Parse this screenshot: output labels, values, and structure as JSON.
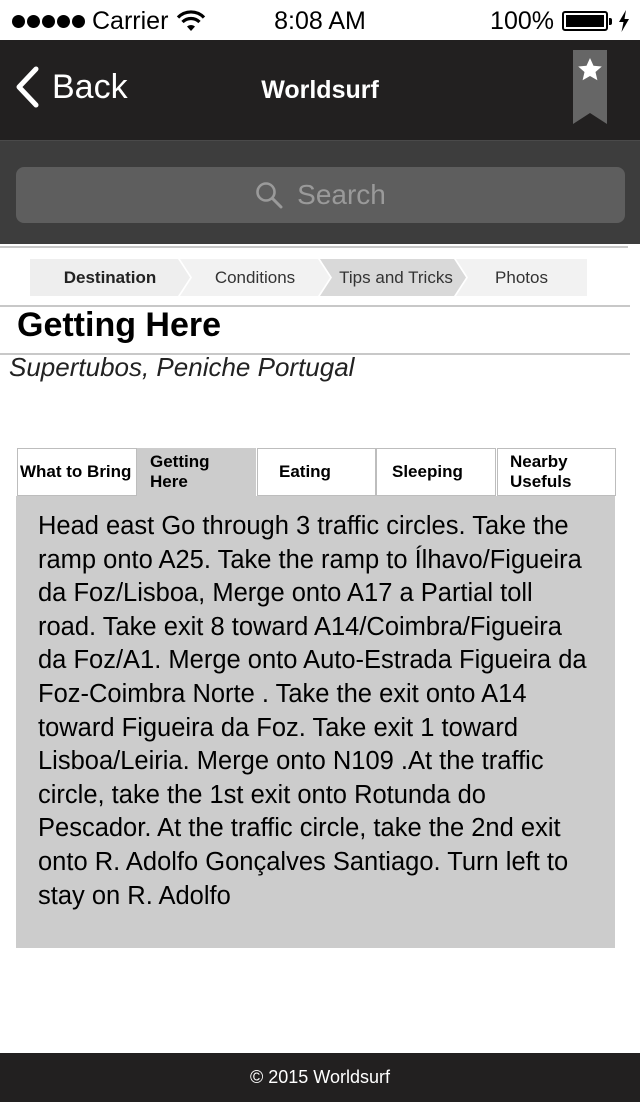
{
  "status_bar": {
    "carrier": "Carrier",
    "time": "8:08 AM",
    "battery": "100%",
    "signal_icon": "signal-dots-icon",
    "wifi_icon": "wifi-icon",
    "battery_icon": "battery-icon",
    "charging_icon": "bolt-icon"
  },
  "nav": {
    "back_label": "Back",
    "title": "Worldsurf",
    "back_icon": "chevron-left-icon",
    "bookmark_icon": "bookmark-star-icon"
  },
  "search": {
    "placeholder": "Search",
    "icon": "search-icon"
  },
  "steps": [
    {
      "label": "Destination",
      "state": "done"
    },
    {
      "label": "Conditions",
      "state": "default"
    },
    {
      "label": "Tips and Tricks",
      "state": "highlight"
    },
    {
      "label": "Photos",
      "state": "default"
    }
  ],
  "page": {
    "title": "Getting Here",
    "subtitle": "Supertubos, Peniche Portugal"
  },
  "tabs": [
    {
      "label": "What to Bring",
      "active": false
    },
    {
      "label": "Getting Here",
      "active": true
    },
    {
      "label": "Eating",
      "active": false
    },
    {
      "label": "Sleeping",
      "active": false
    },
    {
      "label": "Nearby Usefuls",
      "active": false
    }
  ],
  "content": {
    "text": "Head east Go through 3 traffic circles. Take the ramp onto A25. Take the ramp to Ílhavo/Figueira da Foz/Lisboa, Merge onto A17 a Partial toll road. Take exit 8 toward A14/Coimbra/Figueira da Foz/A1. Merge onto Auto-Estrada Figueira da Foz-Coimbra Norte . Take the exit onto A14 toward Figueira da Foz. Take exit 1 toward Lisboa/Leiria. Merge onto N109 .At the traffic circle, take the 1st exit onto Rotunda do Pescador. At the traffic circle, take the 2nd exit onto R. Adolfo Gonçalves Santiago. Turn left to stay on R. Adolfo"
  },
  "footer": {
    "text": "© 2015 Worldsurf"
  },
  "colors": {
    "nav_bg": "#222020",
    "search_bg": "#3d3d3d",
    "search_field": "#5e5e5e",
    "content_bg": "#cccccc",
    "step_default": "#eeeeee",
    "step_highlight": "#d9d9d9"
  }
}
